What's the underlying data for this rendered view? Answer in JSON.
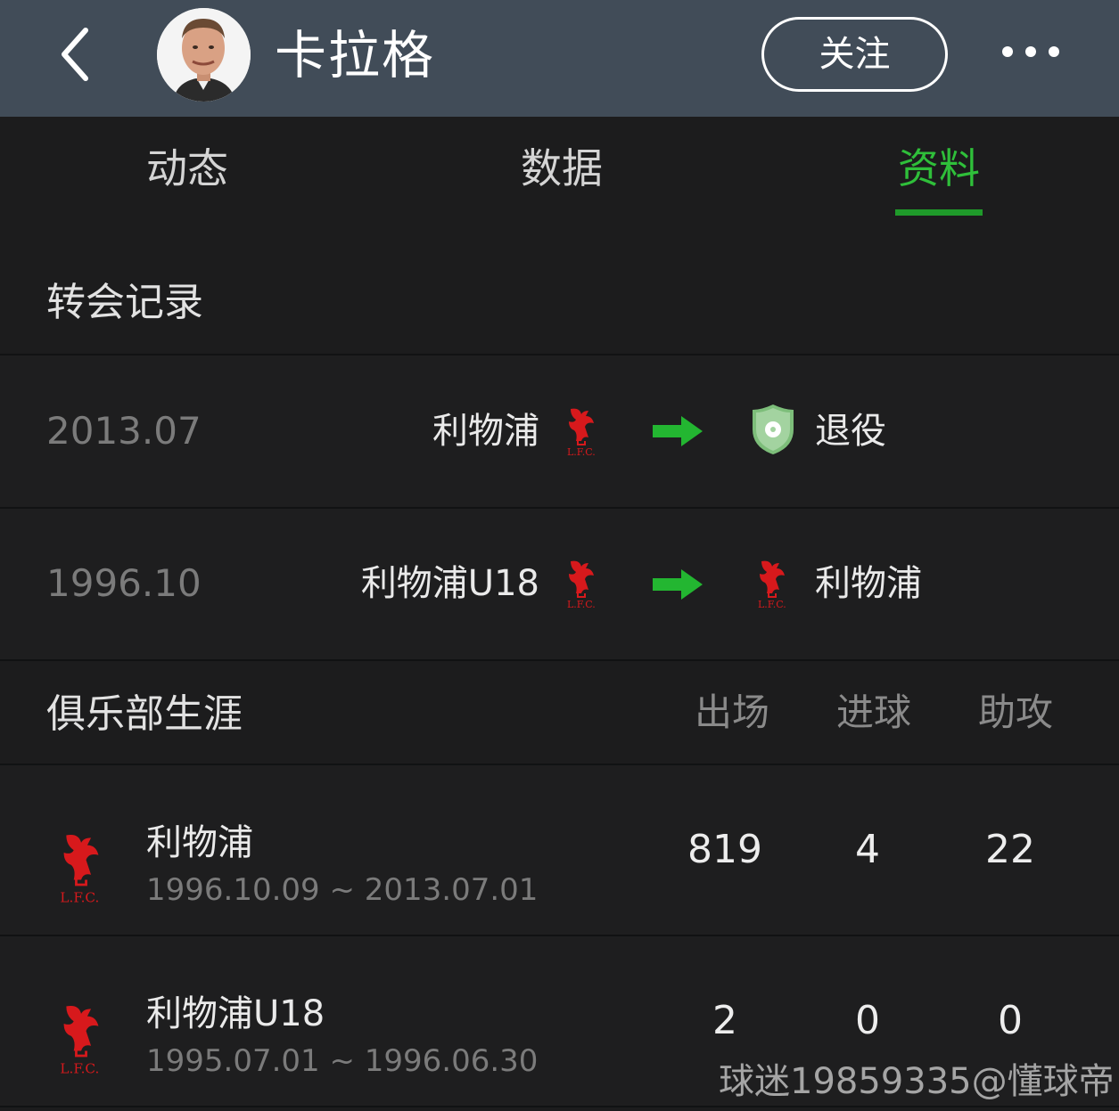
{
  "header": {
    "player_name": "卡拉格",
    "follow_label": "关注",
    "bg_color": "#414c58"
  },
  "tabs": [
    {
      "label": "动态",
      "active": false
    },
    {
      "label": "数据",
      "active": false
    },
    {
      "label": "资料",
      "active": true
    }
  ],
  "accent_color": "#2fbf3a",
  "transfers": {
    "title": "转会记录",
    "records": [
      {
        "date": "2013.07",
        "from": "利物浦",
        "from_icon": "lfc-crest-icon",
        "to": "退役",
        "to_icon": "retired-shield-icon"
      },
      {
        "date": "1996.10",
        "from": "利物浦U18",
        "from_icon": "lfc-crest-icon",
        "to": "利物浦",
        "to_icon": "lfc-crest-icon"
      }
    ]
  },
  "career": {
    "title": "俱乐部生涯",
    "columns": [
      "出场",
      "进球",
      "助攻"
    ],
    "clubs": [
      {
        "name": "利物浦",
        "dates": "1996.10.09 ~ 2013.07.01",
        "apps": "819",
        "goals": "4",
        "assists": "22",
        "icon": "lfc-crest-icon"
      },
      {
        "name": "利物浦U18",
        "dates": "1995.07.01 ~ 1996.06.30",
        "apps": "2",
        "goals": "0",
        "assists": "0",
        "icon": "lfc-crest-icon"
      }
    ]
  },
  "watermark": "球迷19859335@懂球帝"
}
